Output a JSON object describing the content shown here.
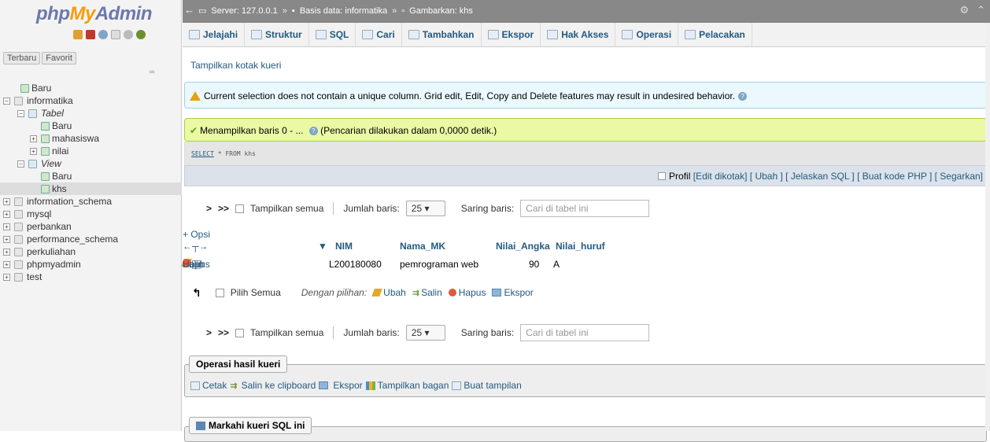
{
  "sidebar": {
    "logo": {
      "php": "php",
      "my": "My",
      "admin": "Admin"
    },
    "recent_label": "Terbaru",
    "favorite_label": "Favorit",
    "tree": [
      {
        "label": "Baru",
        "level": 1
      },
      {
        "label": "informatika",
        "level": 0
      },
      {
        "label": "Tabel",
        "level": 1
      },
      {
        "label": "Baru",
        "level": 2
      },
      {
        "label": "mahasiswa",
        "level": 2
      },
      {
        "label": "nilai",
        "level": 2
      },
      {
        "label": "View",
        "level": 1
      },
      {
        "label": "Baru",
        "level": 2
      },
      {
        "label": "khs",
        "level": 2
      },
      {
        "label": "information_schema",
        "level": 0
      },
      {
        "label": "mysql",
        "level": 0
      },
      {
        "label": "perbankan",
        "level": 0
      },
      {
        "label": "performance_schema",
        "level": 0
      },
      {
        "label": "perkuliahan",
        "level": 0
      },
      {
        "label": "phpmyadmin",
        "level": 0
      },
      {
        "label": "test",
        "level": 0
      }
    ]
  },
  "breadcrumb": {
    "server": "Server: 127.0.0.1",
    "database": "Basis data: informatika",
    "view": "Gambarkan: khs"
  },
  "tabs": [
    "Jelajahi",
    "Struktur",
    "SQL",
    "Cari",
    "Tambahkan",
    "Ekspor",
    "Hak Akses",
    "Operasi",
    "Pelacakan"
  ],
  "show_query_box": "Tampilkan kotak kueri",
  "warning": "Current selection does not contain a unique column. Grid edit, Edit, Copy and Delete features may result in undesired behavior.",
  "success": "Menampilkan baris 0 - ... ",
  "success_time": "(Pencarian dilakukan dalam 0,0000 detik.)",
  "sql": {
    "keyword": "SELECT",
    "rest": " * FROM khs"
  },
  "sql_links": {
    "profil": "Profil",
    "edit_inline": "[Edit dikotak]",
    "edit": "[ Ubah ]",
    "explain": "[ Jelaskan SQL ]",
    "php": "[ Buat kode PHP ]",
    "refresh": "[ Segarkan]"
  },
  "nav": {
    "next": ">",
    "last": ">>",
    "show_all": "Tampilkan semua",
    "rows_label": "Jumlah baris:",
    "rows_value": "25",
    "filter_label": "Saring baris:",
    "filter_placeholder": "Cari di tabel ini"
  },
  "options": "+ Opsi",
  "arrows": "←┬→",
  "columns": [
    "NIM",
    "Nama_MK",
    "Nilai_Angka",
    "Nilai_huruf"
  ],
  "sort_icon": "▼",
  "row": {
    "edit": "Ubah",
    "copy": "Salin",
    "delete": "Hapus",
    "values": [
      "L200180080",
      "pemrograman web",
      "90",
      "A"
    ]
  },
  "bulk": {
    "check_all": "Pilih Semua",
    "with_selected": "Dengan pilihan:",
    "edit": "Ubah",
    "copy": "Salin",
    "delete": "Hapus",
    "export": "Ekspor"
  },
  "query_ops": {
    "legend": "Operasi hasil kueri",
    "print": "Cetak",
    "copy_clipboard": "Salin ke clipboard",
    "export": "Ekspor",
    "chart": "Tampilkan bagan",
    "create_view": "Buat tampilan"
  },
  "bookmark": "Markahi kueri SQL ini",
  "colors": {
    "accent": "#235a81",
    "topbar": "#888888",
    "success_bg": "#ebf8a4",
    "warn_bg": "#ebf8fd"
  }
}
